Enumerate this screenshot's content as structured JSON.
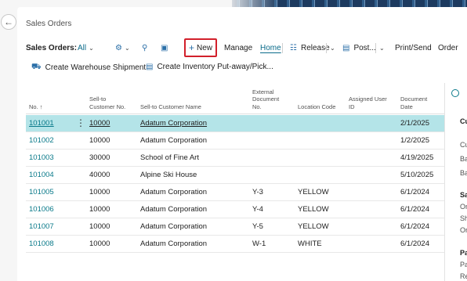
{
  "page": {
    "title": "Sales Orders"
  },
  "actionbar": {
    "view_label": "Sales Orders:",
    "filter_value": "All",
    "new_label": "New",
    "manage_label": "Manage",
    "home_label": "Home",
    "release_label": "Release",
    "post_label": "Post...",
    "print_label": "Print/Send",
    "order_label": "Order"
  },
  "subbar": {
    "warehouse_shipment": "Create Warehouse Shipment",
    "inventory_putaway": "Create Inventory Put-away/Pick..."
  },
  "table": {
    "headers": {
      "no": "No. ↑",
      "sell_to_no_1": "Sell-to",
      "sell_to_no_2": "Customer No.",
      "sell_to_name": "Sell-to Customer Name",
      "ext_doc_1": "External",
      "ext_doc_2": "Document",
      "ext_doc_3": "No.",
      "location": "Location Code",
      "assigned_1": "Assigned User",
      "assigned_2": "ID",
      "doc_date_1": "Document",
      "doc_date_2": "Date"
    },
    "rows": [
      {
        "no": "101001",
        "cust_no": "10000",
        "name": "Adatum Corporation",
        "ext": "",
        "loc": "",
        "user": "",
        "date": "2/1/2025"
      },
      {
        "no": "101002",
        "cust_no": "10000",
        "name": "Adatum Corporation",
        "ext": "",
        "loc": "",
        "user": "",
        "date": "1/2/2025"
      },
      {
        "no": "101003",
        "cust_no": "30000",
        "name": "School of Fine Art",
        "ext": "",
        "loc": "",
        "user": "",
        "date": "4/19/2025"
      },
      {
        "no": "101004",
        "cust_no": "40000",
        "name": "Alpine Ski House",
        "ext": "",
        "loc": "",
        "user": "",
        "date": "5/10/2025"
      },
      {
        "no": "101005",
        "cust_no": "10000",
        "name": "Adatum Corporation",
        "ext": "Y-3",
        "loc": "YELLOW",
        "user": "",
        "date": "6/1/2024"
      },
      {
        "no": "101006",
        "cust_no": "10000",
        "name": "Adatum Corporation",
        "ext": "Y-4",
        "loc": "YELLOW",
        "user": "",
        "date": "6/1/2024"
      },
      {
        "no": "101007",
        "cust_no": "10000",
        "name": "Adatum Corporation",
        "ext": "Y-5",
        "loc": "YELLOW",
        "user": "",
        "date": "6/1/2024"
      },
      {
        "no": "101008",
        "cust_no": "10000",
        "name": "Adatum Corporation",
        "ext": "W-1",
        "loc": "WHITE",
        "user": "",
        "date": "6/1/2024"
      }
    ]
  },
  "factbox": {
    "h1": "Cu",
    "l1": "Cu",
    "l2": "Ba",
    "l3": "Ba",
    "h2": "Sa",
    "l4": "Or",
    "l5": "Sh",
    "l6": "Or",
    "h3": "Pa",
    "l7": "Pa",
    "l8": "Re"
  },
  "colors": {
    "accent": "#0a7a8a",
    "selected_row": "#b4e4e8",
    "highlight_border": "#d2202b"
  }
}
